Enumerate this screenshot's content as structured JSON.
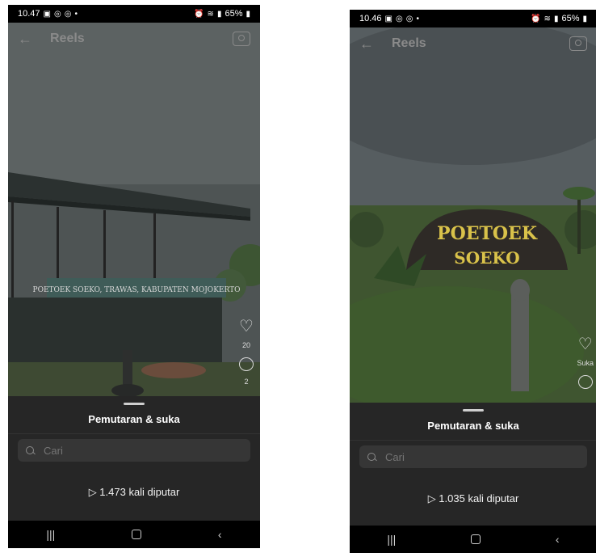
{
  "left": {
    "status": {
      "time": "10.47",
      "battery": "65%"
    },
    "header": {
      "title": "Reels"
    },
    "sign_text": "POETOEK SOEKO, TRAWAS, KABUPATEN MOJOKERTO",
    "likes_count": "20",
    "comments_count": "2",
    "sheet": {
      "title": "Pemutaran & suka",
      "search_placeholder": "Cari",
      "plays": "▷ 1.473 kali diputar"
    }
  },
  "right": {
    "status": {
      "time": "10.46",
      "battery": "65%"
    },
    "header": {
      "title": "Reels"
    },
    "sign_line1": "POETOEK",
    "sign_line2": "SOEKO",
    "like_label": "Suka",
    "sheet": {
      "title": "Pemutaran & suka",
      "search_placeholder": "Cari",
      "plays": "▷ 1.035 kali diputar"
    }
  },
  "colors": {
    "sheet_bg": "#262626",
    "bar_bg": "#000000",
    "sign_yellow": "#d9c24a"
  },
  "icons": [
    "back-arrow-icon",
    "camera-icon",
    "heart-icon",
    "comment-icon",
    "search-icon",
    "recents-icon",
    "home-icon",
    "back-icon"
  ]
}
